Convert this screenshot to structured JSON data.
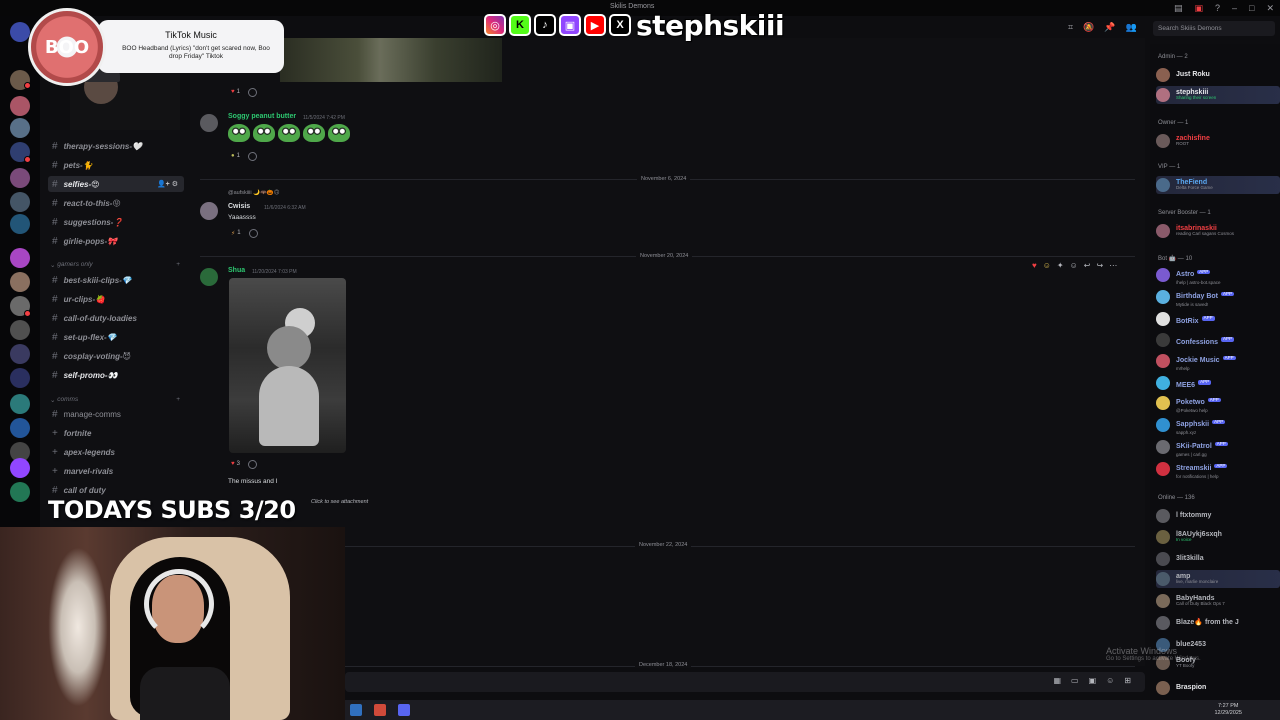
{
  "window": {
    "title": "Skilis Demons"
  },
  "search": {
    "placeholder": "Search Skiiis Demons"
  },
  "overlay": {
    "tiktok_title": "TikTok Music",
    "tiktok_song": "BOO Headband (Lyrics) \"don't get scared now, Boo drop Friday\" Tiktok",
    "tiktok_disc_text": "BOO",
    "handle": "stephskiii",
    "subs_text": "TODAYS SUBS 3/20",
    "social_icons": [
      "instagram-icon",
      "kick-icon",
      "tiktok-icon",
      "twitch-icon",
      "youtube-icon",
      "x-icon"
    ]
  },
  "channels": [
    {
      "label": "therapy-sessions-🤍",
      "state": "normal"
    },
    {
      "label": "pets-🐈",
      "state": "normal"
    },
    {
      "label": "selfies-😍",
      "state": "active"
    },
    {
      "label": "react-to-this-😝",
      "state": "normal"
    },
    {
      "label": "suggestions-❓",
      "state": "normal"
    },
    {
      "label": "girlie-pops-🎀",
      "state": "normal"
    },
    {
      "label": "gamers only",
      "state": "category"
    },
    {
      "label": "best-skiii-clips-💎",
      "state": "normal"
    },
    {
      "label": "ur-clips-🍓",
      "state": "normal"
    },
    {
      "label": "call-of-duty-loadies",
      "state": "normal"
    },
    {
      "label": "set-up-flex-💎",
      "state": "normal"
    },
    {
      "label": "cosplay-voting-😈",
      "state": "normal"
    },
    {
      "label": "self-promo-👀",
      "state": "bold"
    },
    {
      "label": "comms",
      "state": "category"
    },
    {
      "label": "manage-comms",
      "state": "plain"
    },
    {
      "label": "fortnite",
      "state": "voice"
    },
    {
      "label": "apex-legends",
      "state": "voice"
    },
    {
      "label": "marvel-rivals",
      "state": "voice"
    },
    {
      "label": "call of duty",
      "state": "voice"
    }
  ],
  "messages": {
    "msg1": {
      "username": "Soggy peanut butter",
      "timestamp": "11/5/2024 7:42 PM",
      "reaction_count": "1"
    },
    "top_reaction_count": "1",
    "date1": "November 6, 2024",
    "msg2": {
      "reply": "@aufskiiii 🌙🦇🎃🙃",
      "username": "Cwisis",
      "timestamp": "11/6/2024 6:32 AM",
      "text": "Yaaassss",
      "reaction_count": "1"
    },
    "date2": "November 20, 2024",
    "msg3": {
      "username": "Shua",
      "timestamp": "11/20/2024 7:03 PM",
      "text": "The missus and I",
      "reaction_count": "3",
      "reply_snippet": "Click to see attachment"
    },
    "date3": "November 22, 2024",
    "date4": "December 18, 2024"
  },
  "members": {
    "groups": {
      "admin": "Admin — 2",
      "owner": "Owner — 1",
      "vip": "VIP — 1",
      "booster": "Server Booster — 1",
      "bot": "Bot 🤖 — 10",
      "online": "Online — 136"
    },
    "admin": [
      {
        "name": "Just Roku",
        "sub": "",
        "color": "#e6e7ea"
      },
      {
        "name": "stephskiii",
        "sub": "Sharing their screen",
        "color": "#e6e7ea"
      }
    ],
    "owner": [
      {
        "name": "zachisfine",
        "sub": "ROOT",
        "color": "#f23f43"
      }
    ],
    "vip": [
      {
        "name": "TheFiend",
        "sub": "Delta Force Game",
        "color": "#5aa7f0"
      }
    ],
    "booster": [
      {
        "name": "itsabrinaskii",
        "sub": "reading Carl sagans Cosmos",
        "color": "#f23f43"
      }
    ],
    "bots": [
      {
        "name": "Astro",
        "sub": "/help | astro-bot.space"
      },
      {
        "name": "Birthday Bot",
        "sub": "Mytide is saved!"
      },
      {
        "name": "BotRix",
        "sub": ""
      },
      {
        "name": "Confessions",
        "sub": ""
      },
      {
        "name": "Jockie Music",
        "sub": "m!help"
      },
      {
        "name": "MEE6",
        "sub": ""
      },
      {
        "name": "Poketwo",
        "sub": "@Poketwo help"
      },
      {
        "name": "Sapphskii",
        "sub": "sapph.xyz"
      },
      {
        "name": "SKii-Patrol",
        "sub": "games | carl.gg"
      },
      {
        "name": "Streamskii",
        "sub": "for notifications | help"
      }
    ],
    "app_tag": "APP",
    "online": [
      {
        "name": "l ftxtommy",
        "sub": ""
      },
      {
        "name": "l8AUykj6sxqh",
        "sub": "In voice"
      },
      {
        "name": "3lit3killa",
        "sub": ""
      },
      {
        "name": "amp",
        "sub": "live, marlie monclaire"
      },
      {
        "name": "BabyHands",
        "sub": "Call of Duty Black Ops 7"
      },
      {
        "name": "Blaze🔥 from the J",
        "sub": ""
      },
      {
        "name": "blue2453",
        "sub": ""
      },
      {
        "name": "Boofy",
        "sub": "YT Boofy"
      },
      {
        "name": "Braspion",
        "sub": ""
      }
    ]
  },
  "system": {
    "activate_title": "Activate Windows",
    "activate_sub": "Go to Settings to activate Windows.",
    "time": "7:27 PM",
    "date": "12/29/2025"
  },
  "colors": {
    "accent": "#5865f2",
    "danger": "#f23f43",
    "soggy": "#2dc770",
    "shua": "#2dc770"
  }
}
